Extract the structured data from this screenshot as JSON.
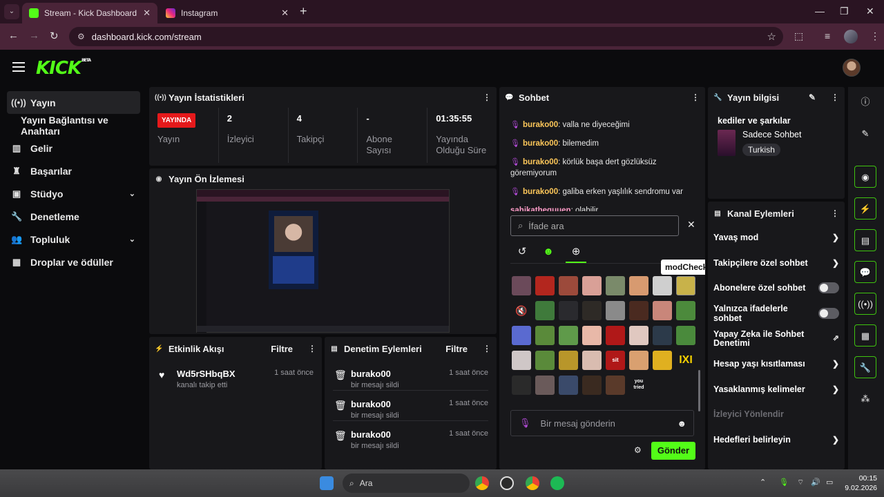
{
  "browser": {
    "tabs": [
      {
        "title": "Stream - Kick Dashboard",
        "active": true
      },
      {
        "title": "Instagram",
        "active": false
      }
    ],
    "new_tab": "+",
    "url": "dashboard.kick.com/stream",
    "win_min": "—",
    "win_max": "❐",
    "win_close": "✕"
  },
  "app": {
    "logo": "KICK",
    "logo_sup": "BETA"
  },
  "sidebar": {
    "items": [
      {
        "label": "Yayın",
        "icon": "broadcast-icon"
      },
      {
        "label": "Yayın Bağlantısı ve Anahtarı"
      },
      {
        "label": "Gelir",
        "icon": "revenue-icon"
      },
      {
        "label": "Başarılar",
        "icon": "trophy-icon"
      },
      {
        "label": "Stüdyo",
        "icon": "studio-icon"
      },
      {
        "label": "Denetleme",
        "icon": "wrench-icon"
      },
      {
        "label": "Topluluk",
        "icon": "community-icon"
      },
      {
        "label": "Droplar ve ödüller",
        "icon": "drops-icon"
      }
    ]
  },
  "stats": {
    "title": "Yayın İstatistikleri",
    "live_badge": "YAYINDA",
    "items": [
      {
        "value": "",
        "label": "Yayın"
      },
      {
        "value": "2",
        "label": "İzleyici"
      },
      {
        "value": "4",
        "label": "Takipçi"
      },
      {
        "value": "-",
        "label": "Abone Sayısı"
      },
      {
        "value": "01:35:55",
        "label": "Yayında Olduğu Süre"
      }
    ]
  },
  "preview": {
    "title": "Yayın Ön İzlemesi"
  },
  "activity": {
    "title": "Etkinlik Akışı",
    "filter": "Filtre",
    "items": [
      {
        "name": "Wd5rSHbqBX",
        "desc": "kanalı takip etti",
        "time": "1 saat önce"
      }
    ]
  },
  "moderation": {
    "title": "Denetim Eylemleri",
    "filter": "Filtre",
    "items": [
      {
        "name": "burako00",
        "desc": "bir mesajı sildi",
        "time": "1 saat önce"
      },
      {
        "name": "burako00",
        "desc": "bir mesajı sildi",
        "time": "1 saat önce"
      },
      {
        "name": "burako00",
        "desc": "bir mesajı sildi",
        "time": "1 saat önce"
      }
    ]
  },
  "chat": {
    "title": "Sohbet",
    "messages": [
      {
        "user": "burako00",
        "text": ": valla ne diyeceğimi"
      },
      {
        "user": "burako00",
        "text": ": bilemedim"
      },
      {
        "user": "burako00",
        "text": ": körlük başa dert gözlüksüz göremiyorum"
      },
      {
        "user": "burako00",
        "text": ": galiba erken yaşlılık sendromu var"
      },
      {
        "user": "sahikathequuen",
        "text": ": olabilir"
      }
    ],
    "emote_search_placeholder": "İfade ara",
    "tooltip": "modCheck",
    "input_placeholder": "Bir mesaj gönderin",
    "send": "Gönder",
    "emote_text_sit": "sit",
    "emote_text_ixi": "IXI",
    "emote_text_you_tried": "you tried"
  },
  "stream_info": {
    "title": "Yayın bilgisi",
    "stream_title": "kediler ve şarkılar",
    "category": "Sadece Sohbet",
    "language": "Turkish"
  },
  "channel_actions": {
    "title": "Kanal Eylemleri",
    "items": [
      {
        "label": "Yavaş mod",
        "control": "arrow"
      },
      {
        "label": "Takipçilere özel sohbet",
        "control": "arrow"
      },
      {
        "label": "Abonelere özel sohbet",
        "control": "toggle"
      },
      {
        "label": "Yalnızca ifadelerle sohbet",
        "control": "toggle"
      },
      {
        "label": "Yapay Zeka ile Sohbet Denetimi",
        "control": "external"
      },
      {
        "label": "Hesap yaşı kısıtlaması",
        "control": "arrow"
      },
      {
        "label": "Yasaklanmış kelimeler",
        "control": "arrow"
      },
      {
        "label": "İzleyici Yönlendir",
        "control": "disabled"
      },
      {
        "label": "Hedefleri belirleyin",
        "control": "arrow"
      }
    ]
  },
  "taskbar": {
    "search": "Ara",
    "time": "00:15",
    "date": "9.02.2026"
  },
  "colors": {
    "accent": "#53fc18",
    "live": "#e5191b",
    "panel": "#18181b",
    "chrome": "#4a2438"
  }
}
